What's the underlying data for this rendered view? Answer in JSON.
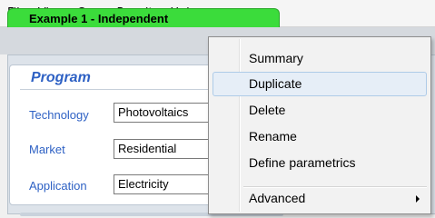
{
  "menubar": {
    "items": [
      "File",
      "View",
      "Case",
      "Results",
      "Help"
    ]
  },
  "case_tab": {
    "label": "Example 1 - Independent",
    "color": "#3bdc3b"
  },
  "program": {
    "title": "Program",
    "fields": [
      {
        "label": "Technology",
        "value": "Photovoltaics"
      },
      {
        "label": "Market",
        "value": "Residential"
      },
      {
        "label": "Application",
        "value": "Electricity"
      }
    ]
  },
  "context_menu": {
    "items": [
      {
        "label": "Summary"
      },
      {
        "label": "Duplicate",
        "highlighted": true
      },
      {
        "label": "Delete"
      },
      {
        "label": "Rename"
      },
      {
        "label": "Define parametrics"
      },
      {
        "label": "Advanced",
        "has_submenu": true
      }
    ],
    "submenu_icon": "chevron-right-icon"
  },
  "colors": {
    "accent_text": "#2e61c4",
    "highlight_bg": "#e6eef7"
  }
}
